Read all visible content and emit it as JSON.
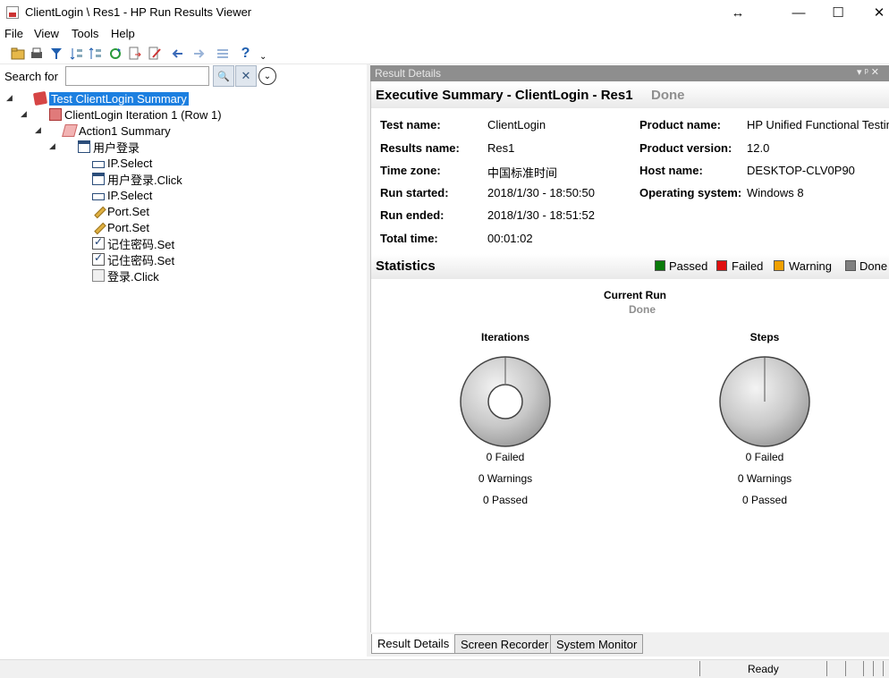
{
  "window": {
    "title": "ClientLogin \\ Res1 - HP Run Results Viewer",
    "resize_glyph": "↔",
    "minimize": "—",
    "maximize": "☐",
    "close": "✕"
  },
  "menu": [
    "File",
    "View",
    "Tools",
    "Help"
  ],
  "toolbar_icons": [
    "open-icon",
    "print-icon",
    "filter-icon",
    "expand-icon",
    "collapse-icon",
    "refresh-icon",
    "export-icon",
    "edit-icon",
    "back-icon",
    "forward-icon",
    "list-icon",
    "help-icon"
  ],
  "search": {
    "label": "Search for",
    "value": "",
    "search_glyph": "🔍",
    "clear_glyph": "✕",
    "options_glyph": "⌄"
  },
  "tree": [
    {
      "label": "Test ClientLogin Summary",
      "icon": "summary-icon",
      "selected": true
    },
    {
      "label": "ClientLogin Iteration 1 (Row 1)",
      "icon": "iteration-icon"
    },
    {
      "label": "Action1 Summary",
      "icon": "action-icon"
    },
    {
      "label": "用户登录",
      "icon": "window-icon"
    },
    {
      "label": "IP.Select",
      "icon": "combobox-icon"
    },
    {
      "label": "用户登录.Click",
      "icon": "window-icon"
    },
    {
      "label": "IP.Select",
      "icon": "combobox-icon"
    },
    {
      "label": "Port.Set",
      "icon": "edit-field-icon"
    },
    {
      "label": "Port.Set",
      "icon": "edit-field-icon"
    },
    {
      "label": "记住密码.Set",
      "icon": "checkbox-icon"
    },
    {
      "label": "记住密码.Set",
      "icon": "checkbox-icon"
    },
    {
      "label": "登录.Click",
      "icon": "button-icon"
    }
  ],
  "result_details": {
    "header": "Result Details",
    "header_controls": "▾ ᵖ ✕",
    "exec_title": "Executive Summary - ClientLogin - Res1",
    "exec_status": "Done",
    "left_info": [
      {
        "key": "Test name:",
        "value": "ClientLogin"
      },
      {
        "key": "Results name:",
        "value": "Res1"
      },
      {
        "key": "Time zone:",
        "value": "中国标准时间"
      },
      {
        "key": "Run started:",
        "value": "2018/1/30 - 18:50:50"
      },
      {
        "key": "Run ended:",
        "value": "2018/1/30 - 18:51:52"
      },
      {
        "key": "Total time:",
        "value": "00:01:02"
      }
    ],
    "right_info": [
      {
        "key": "Product name:",
        "value": "HP Unified Functional Testing"
      },
      {
        "key": "Product version:",
        "value": "12.0"
      },
      {
        "key": "Host name:",
        "value": "DESKTOP-CLV0P90"
      },
      {
        "key": "Operating system:",
        "value": "Windows 8"
      }
    ]
  },
  "statistics": {
    "title": "Statistics",
    "legend": [
      {
        "label": "Passed",
        "color": "#0a7a0a"
      },
      {
        "label": "Failed",
        "color": "#e01010"
      },
      {
        "label": "Warning",
        "color": "#f0a000"
      },
      {
        "label": "Done",
        "color": "#808080"
      }
    ],
    "current_run_label": "Current Run",
    "current_run_status": "Done",
    "iterations": {
      "title": "Iterations",
      "failed": "0 Failed",
      "warnings": "0 Warnings",
      "passed": "0 Passed"
    },
    "steps": {
      "title": "Steps",
      "failed": "0 Failed",
      "warnings": "0 Warnings",
      "passed": "0 Passed"
    }
  },
  "tabs": [
    "Result Details",
    "Screen Recorder",
    "System Monitor"
  ],
  "status": {
    "text": "Ready"
  }
}
